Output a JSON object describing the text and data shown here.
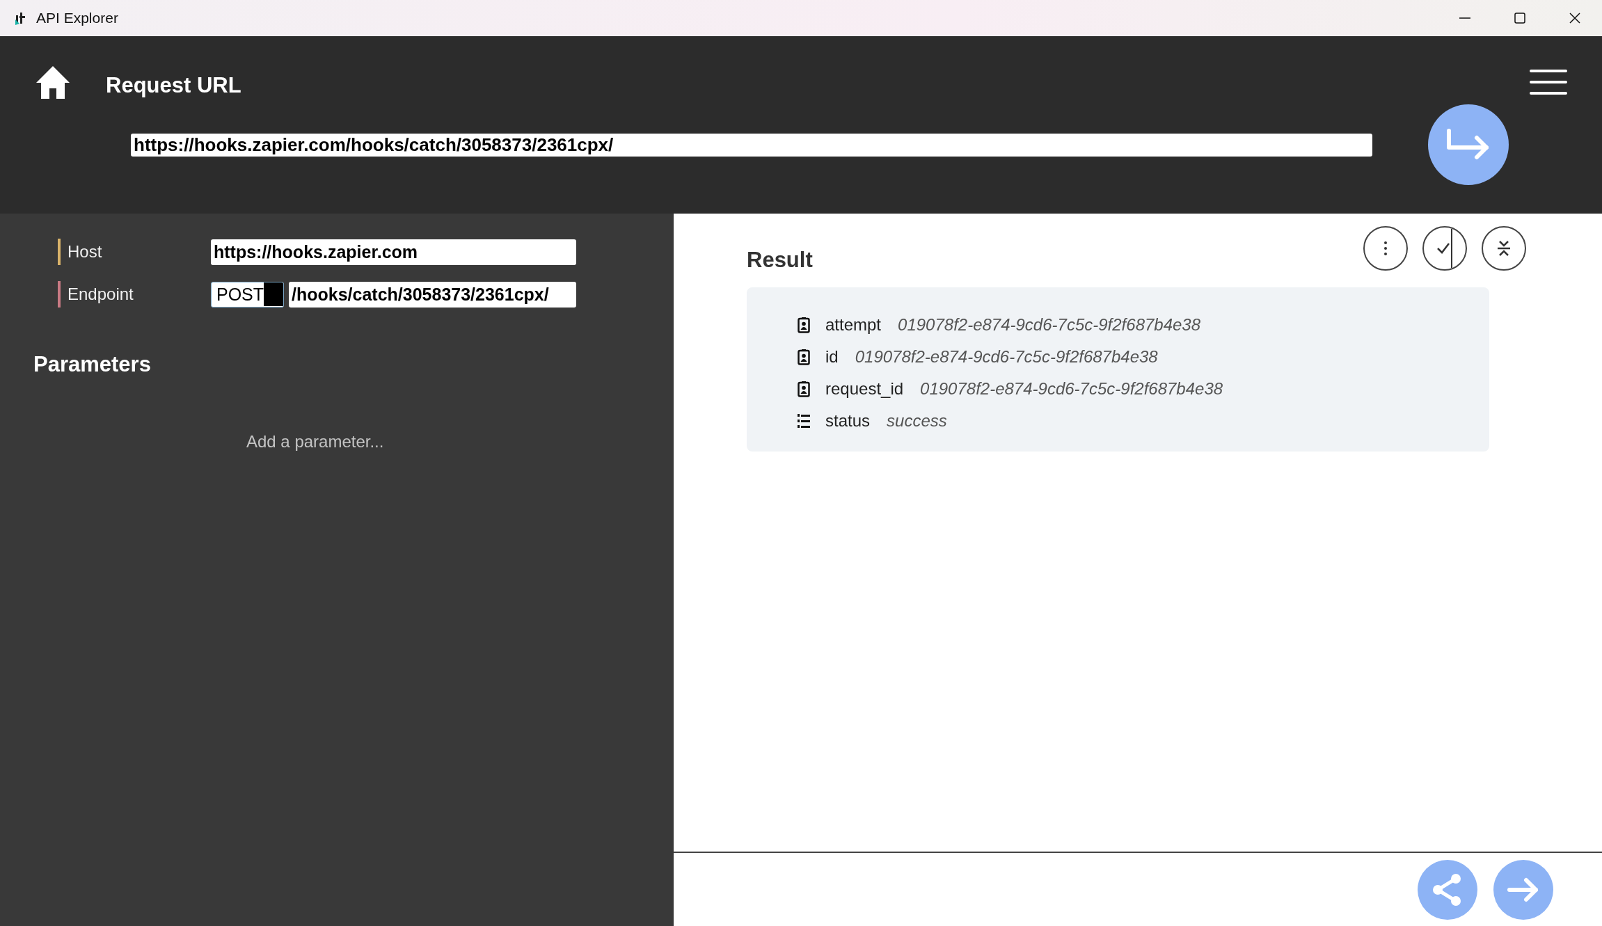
{
  "window": {
    "title": "API Explorer"
  },
  "header": {
    "title": "Request URL",
    "url": "https://hooks.zapier.com/hooks/catch/3058373/2361cpx/"
  },
  "request": {
    "fields": [
      {
        "kind": "text",
        "label": "Host",
        "color": "#d9b36a",
        "value": "https://hooks.zapier.com"
      },
      {
        "kind": "endpoint",
        "label": "Endpoint",
        "color": "#c97a84",
        "method": "POST",
        "value": "/hooks/catch/3058373/2361cpx/"
      }
    ]
  },
  "parameters": {
    "title": "Parameters",
    "empty_text": "Add a parameter..."
  },
  "result": {
    "title": "Result",
    "rows": [
      {
        "kind": "record",
        "key": "attempt",
        "value": "019078f2-e874-9cd6-7c5c-9f2f687b4e38"
      },
      {
        "kind": "record",
        "key": "id",
        "value": "019078f2-e874-9cd6-7c5c-9f2f687b4e38"
      },
      {
        "kind": "record",
        "key": "request_id",
        "value": "019078f2-e874-9cd6-7c5c-9f2f687b4e38"
      },
      {
        "kind": "list",
        "key": "status",
        "value": "success"
      }
    ]
  }
}
